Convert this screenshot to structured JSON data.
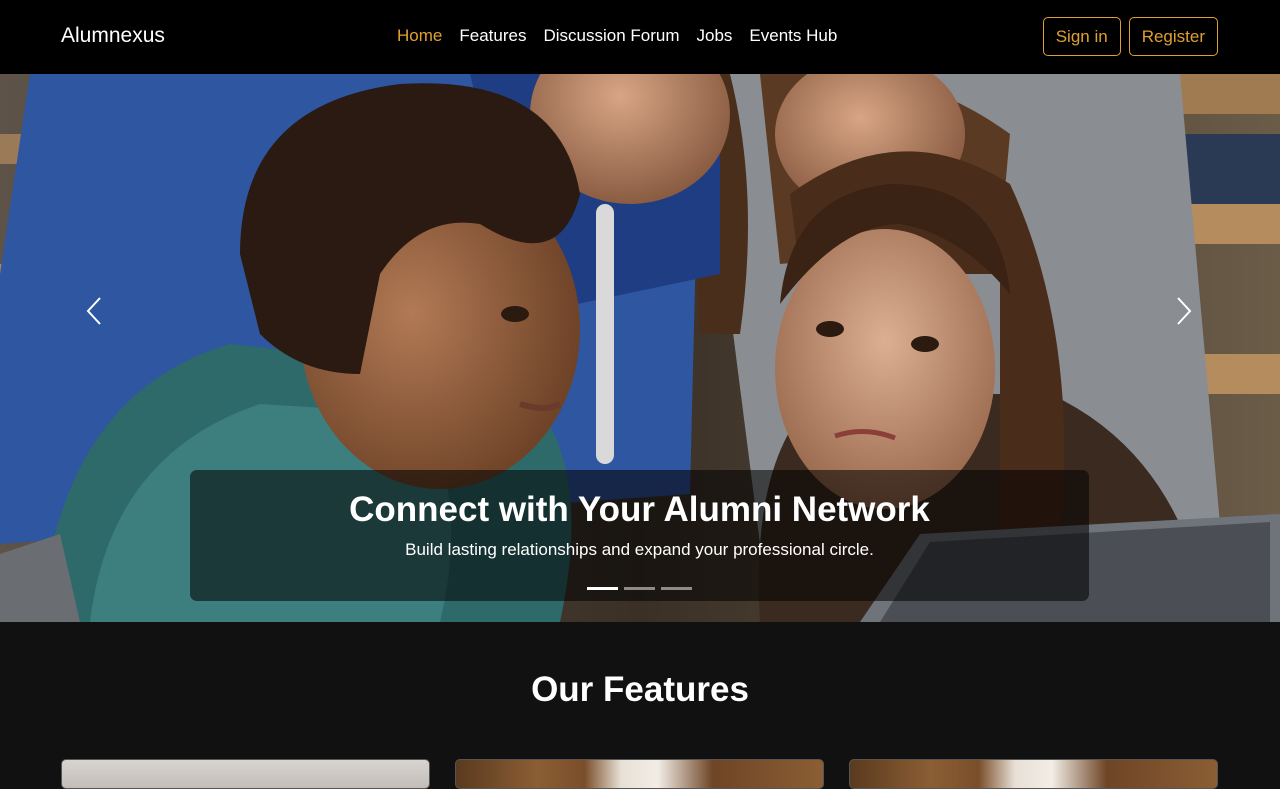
{
  "brand": "Alumnexus",
  "nav": {
    "home": "Home",
    "features": "Features",
    "forum": "Discussion Forum",
    "jobs": "Jobs",
    "events": "Events Hub"
  },
  "auth": {
    "signin": "Sign in",
    "register": "Register"
  },
  "hero": {
    "title": "Connect with Your Alumni Network",
    "subtitle": "Build lasting relationships and expand your professional circle.",
    "slide_count": 3,
    "active_slide": 1
  },
  "features": {
    "title": "Our Features"
  },
  "colors": {
    "accent": "#e0a030",
    "navbar": "#000000",
    "section_bg": "#111111"
  },
  "icons": {
    "prev": "chevron-left-icon",
    "next": "chevron-right-icon"
  }
}
